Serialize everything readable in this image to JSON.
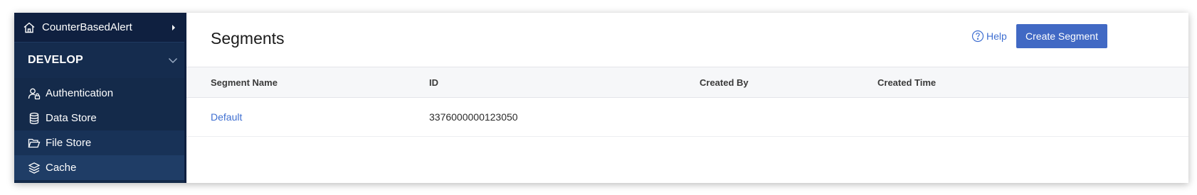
{
  "sidebar": {
    "project_name": "CounterBasedAlert",
    "section_title": "DEVELOP",
    "items": [
      {
        "label": "Authentication",
        "icon": "user-lock-icon"
      },
      {
        "label": "Data Store",
        "icon": "database-icon"
      },
      {
        "label": "File Store",
        "icon": "folder-open-icon"
      },
      {
        "label": "Cache",
        "icon": "layers-icon"
      }
    ],
    "active_item": "Cache"
  },
  "header": {
    "title": "Segments",
    "help_label": "Help",
    "create_label": "Create Segment"
  },
  "table": {
    "columns": [
      "Segment Name",
      "ID",
      "Created By",
      "Created Time"
    ],
    "rows": [
      {
        "name": "Default",
        "id": "3376000000123050",
        "created_by": "",
        "created_time": ""
      }
    ]
  },
  "colors": {
    "sidebar_bg": "#142a4a",
    "accent": "#4169c4",
    "link": "#3f6fd1"
  }
}
